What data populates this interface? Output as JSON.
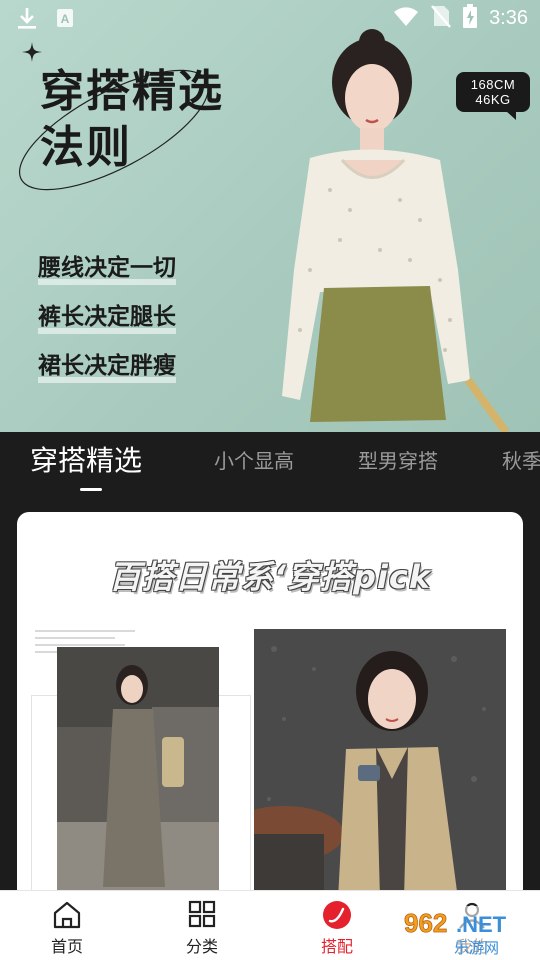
{
  "status_bar": {
    "time": "3:36",
    "icons": [
      "download-icon",
      "text-a-icon",
      "wifi-icon",
      "no-sim-icon",
      "battery-charging-icon"
    ]
  },
  "hero": {
    "title_line1": "穿搭精选",
    "title_line2": "法则",
    "rules": [
      "腰线决定一切",
      "裤长决定腿长",
      "裙长决定胖瘦"
    ],
    "size_height": "168CM",
    "size_weight": "46KG"
  },
  "tabs": [
    {
      "label": "穿搭精选",
      "active": true
    },
    {
      "label": "小个显高",
      "active": false
    },
    {
      "label": "型男穿搭",
      "active": false
    },
    {
      "label": "秋季",
      "active": false
    }
  ],
  "card": {
    "title": "百搭日常系‘穿搭pick"
  },
  "bottom_nav": [
    {
      "label": "首页",
      "icon": "home-icon",
      "active": false
    },
    {
      "label": "分类",
      "icon": "grid-icon",
      "active": false
    },
    {
      "label": "搭配",
      "icon": "outfit-icon",
      "active": true
    },
    {
      "label": "我的",
      "icon": "profile-icon",
      "active": false
    }
  ],
  "watermark": {
    "brand": "962.NET",
    "sub": "乐游网"
  },
  "colors": {
    "accent": "#e4212c",
    "hero_bg": "#aacdc1",
    "tab_bar_bg": "#1c1c1c"
  }
}
